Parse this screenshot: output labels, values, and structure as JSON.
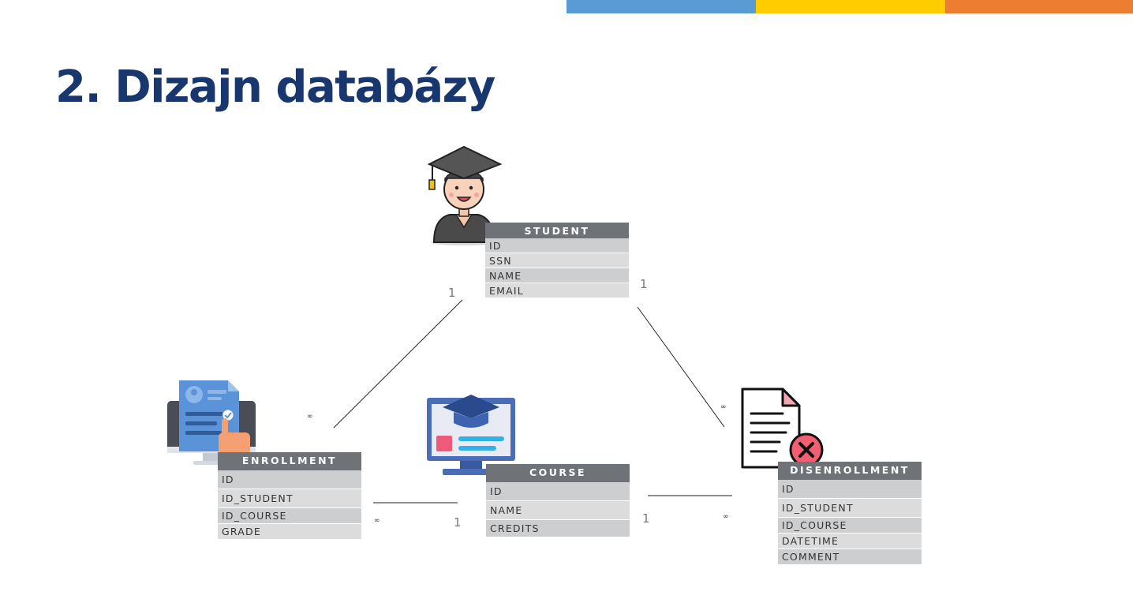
{
  "slide": {
    "title": "2. Dizajn databázy",
    "accent_colors": [
      "#5b9bd5",
      "#ffcc00",
      "#ed7d31"
    ]
  },
  "entities": {
    "student": {
      "name": "STUDENT",
      "fields": [
        "ID",
        "SSN",
        "NAME",
        "EMAIL"
      ]
    },
    "enrollment": {
      "name": "ENROLLMENT",
      "fields": [
        "ID",
        "ID_STUDENT",
        "ID_COURSE",
        "GRADE"
      ]
    },
    "course": {
      "name": "COURSE",
      "fields": [
        "ID",
        "NAME",
        "CREDITS"
      ]
    },
    "disenrollment": {
      "name": "DISENROLLMENT",
      "fields": [
        "ID",
        "ID_STUDENT",
        "ID_COURSE",
        "DATETIME",
        "COMMENT"
      ]
    }
  },
  "relations": {
    "student_enrollment": {
      "one": "1",
      "many": "∞"
    },
    "student_disenrollment": {
      "one": "1",
      "many": "∞"
    },
    "course_enrollment": {
      "one": "1",
      "many": "∞"
    },
    "course_disenrollment": {
      "one": "1",
      "many": "∞"
    }
  },
  "icons": [
    "graduate-student-icon",
    "enrollment-form-icon",
    "online-course-icon",
    "document-cancel-icon"
  ]
}
